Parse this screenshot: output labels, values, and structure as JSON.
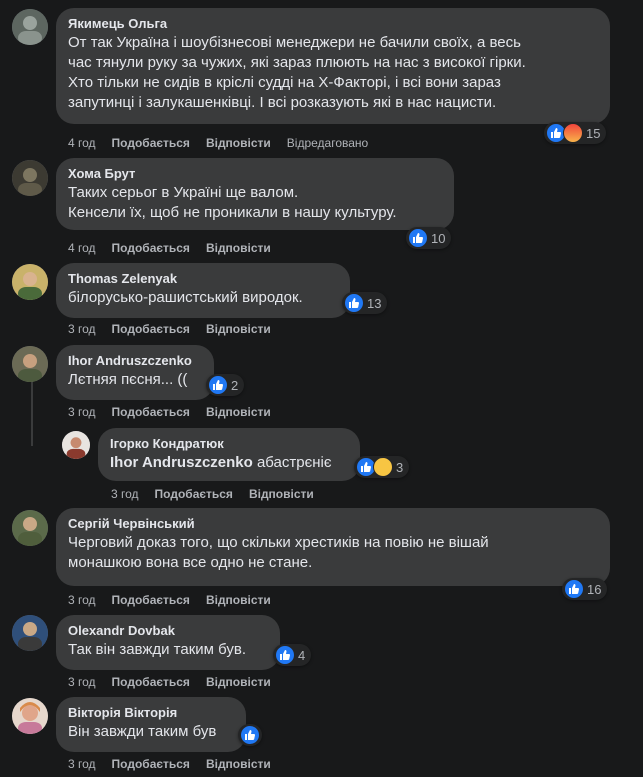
{
  "actions": {
    "like": "Подобається",
    "reply": "Відповісти"
  },
  "comments": [
    {
      "author": "Якимець Ольга",
      "text": "От так Україна і шоубізнесові менеджери не бачили своїх, а весь\nчас тянули руку за чужих, які зараз плюють на нас з високої гірки.\nХто тільки не сидів в кріслі судді на Х-Факторі, і всі вони зараз\nзапутинці і залукашенківці. І всі розказують які в нас нацисти.",
      "time": "4 год",
      "edited": "Відредаговано",
      "reaction_count": "15"
    },
    {
      "author": "Хома Брут",
      "text": "Таких серьог в Україні ще валом.\nКенсели їх, щоб не проникали в нашу культуру.",
      "time": "4 год",
      "reaction_count": "10"
    },
    {
      "author": "Thomas Zelenyak",
      "text": "білорусько-рашистський виродок.",
      "time": "3 год",
      "reaction_count": "13"
    },
    {
      "author": "Ihor Andruszczenko",
      "text": "Лєтняя пєсня... ((",
      "time": "3 год",
      "reaction_count": "2"
    },
    {
      "author": "Ігорко Кондратюк",
      "mention": "Ihor Andruszczenko",
      "text": " абастрєніє",
      "time": "3 год",
      "reaction_count": "3"
    },
    {
      "author": "Сергій Червінський",
      "text": "Черговий доказ того, що скільки хрестиків на повію не вішай\nмонашкою вона все одно не стане.",
      "time": "3 год",
      "reaction_count": "16"
    },
    {
      "author": "Olexandr Dovbak",
      "text": "Так він завжди таким був.",
      "time": "3 год",
      "reaction_count": "4"
    },
    {
      "author": "Вікторія Вікторія",
      "text": "Він завжди таким був",
      "time": "3 год",
      "reaction_count": ""
    }
  ]
}
